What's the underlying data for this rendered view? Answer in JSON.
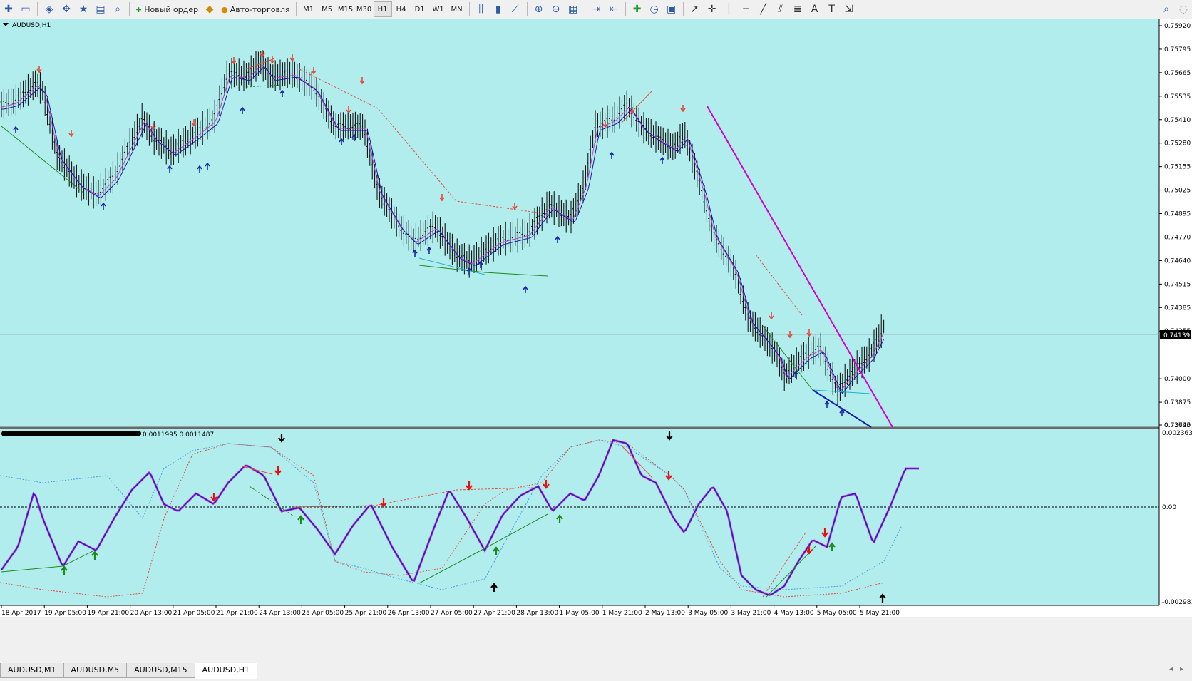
{
  "toolbar": {
    "new_order_label": "Новый ордер",
    "auto_trading_label": "Авто-торговля",
    "timeframes": [
      "M1",
      "M5",
      "M15",
      "M30",
      "H1",
      "H4",
      "D1",
      "W1",
      "MN"
    ],
    "active_timeframe": "H1"
  },
  "chart": {
    "symbol_label": "AUDUSD,H1",
    "current_price": "0.74139",
    "price_ticks": [
      "0.75920",
      "0.75795",
      "0.75665",
      "0.75535",
      "0.75410",
      "0.75280",
      "0.75155",
      "0.75025",
      "0.74895",
      "0.74770",
      "0.74640",
      "0.74515",
      "0.74385",
      "0.74255",
      "0.74000",
      "0.73875",
      "0.73745",
      "0.73620"
    ],
    "indicator_label": "0.0011995 0.0011487",
    "indicator_ticks": [
      "0.002363",
      "0.00",
      "-0.002981"
    ],
    "time_ticks": [
      "18 Apr 2017",
      "19 Apr 05:00",
      "19 Apr 21:00",
      "20 Apr 13:00",
      "21 Apr 05:00",
      "21 Apr 21:00",
      "24 Apr 13:00",
      "25 Apr 05:00",
      "25 Apr 21:00",
      "26 Apr 13:00",
      "27 Apr 05:00",
      "27 Apr 21:00",
      "28 Apr 13:00",
      "1 May 05:00",
      "1 May 21:00",
      "2 May 13:00",
      "3 May 05:00",
      "3 May 21:00",
      "4 May 13:00",
      "5 May 05:00",
      "5 May 21:00"
    ],
    "colors": {
      "background": "#b2eded",
      "candle": "#000000",
      "ma_fast": "#1a1aa8",
      "ma_slow": "#c040c0",
      "up_arrow": "#1a2aa0",
      "down_arrow": "#e84a3a",
      "trend": "#d000d0"
    }
  },
  "tabs": [
    "AUDUSD,M1",
    "AUDUSD,M5",
    "AUDUSD,M15",
    "AUDUSD,H1"
  ],
  "active_tab": "AUDUSD,H1"
}
